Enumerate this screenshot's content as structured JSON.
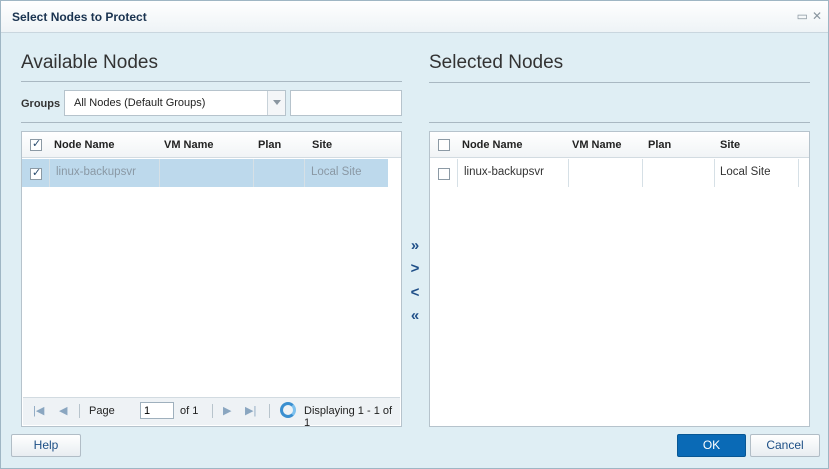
{
  "dialog": {
    "title": "Select Nodes to Protect",
    "title_icons": [
      "restore-icon",
      "close-icon"
    ]
  },
  "available": {
    "title": "Available Nodes",
    "groups_label": "Groups",
    "groups_value": "All Nodes (Default Groups)",
    "search_value": "",
    "columns": [
      "Node Name",
      "VM Name",
      "Plan",
      "Site"
    ],
    "header_checked": true,
    "rows": [
      {
        "node_name": "linux-backupsvr",
        "vm_name": "",
        "plan": "",
        "site": "Local Site",
        "checked": true,
        "selected": true
      }
    ],
    "pager": {
      "page_label": "Page",
      "page_value": "1",
      "of_label": "of 1",
      "display_text": "Displaying 1 - 1 of 1"
    }
  },
  "selected": {
    "title": "Selected Nodes",
    "columns": [
      "Node Name",
      "VM Name",
      "Plan",
      "Site"
    ],
    "header_checked": false,
    "rows": [
      {
        "node_name": "linux-backupsvr",
        "vm_name": "",
        "plan": "",
        "site": "Local Site",
        "checked": false,
        "selected": false
      }
    ]
  },
  "movers": {
    "add_all": "»",
    "add": ">",
    "remove": "<",
    "remove_all": "«"
  },
  "footer": {
    "help_label": "Help",
    "ok_label": "OK",
    "cancel_label": "Cancel"
  },
  "colors": {
    "accent": "#0a6ab6",
    "selected_row": "#bdd9ec",
    "background": "#dfeef4"
  }
}
